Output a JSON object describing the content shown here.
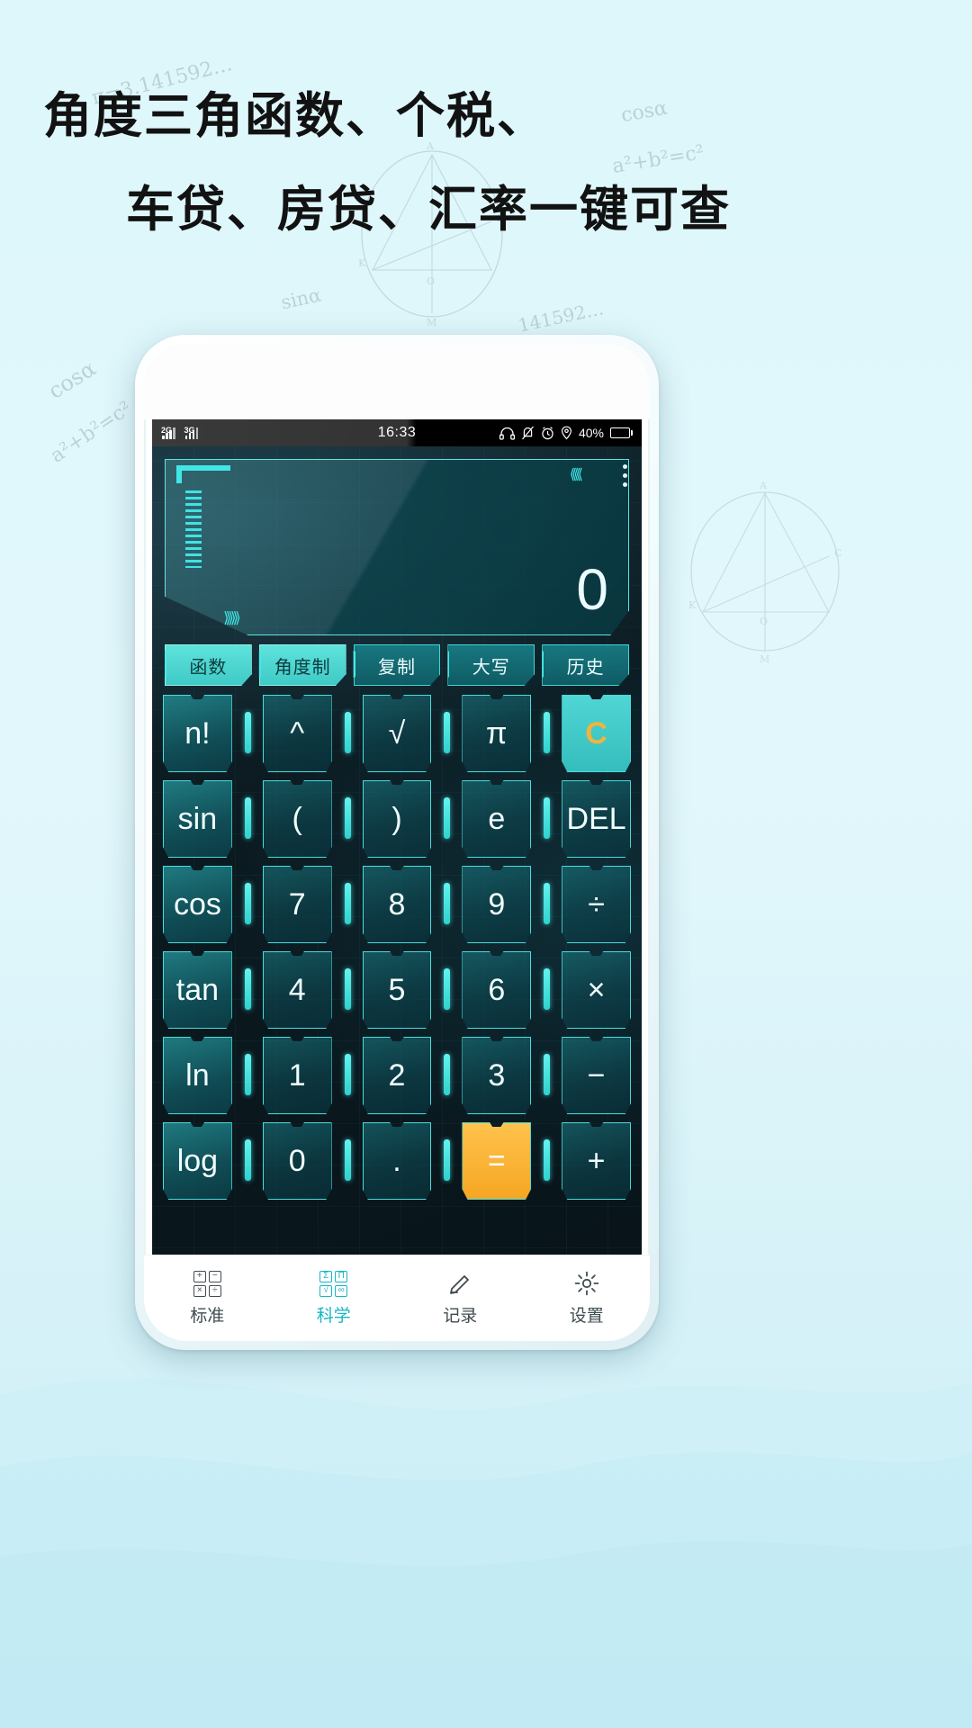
{
  "promo": {
    "line1": "角度三角函数、个税、",
    "line2": "车贷、房贷、汇率一键可查",
    "doodles": [
      "π=3.141592…",
      "cosα",
      "a²+b²=c²",
      "sinα",
      "141592…",
      "cosα",
      "a²+b²=c²"
    ]
  },
  "statusbar": {
    "net2g": "2G",
    "net3g": "3G",
    "time": "16:33",
    "battery_percent": "40%",
    "icons": [
      "headset-icon",
      "mute-bell-icon",
      "alarm-icon",
      "location-icon",
      "battery-icon"
    ]
  },
  "display": {
    "value": "0",
    "menu_icon": "kebab-menu-icon"
  },
  "chips": [
    {
      "label": "函数",
      "active": true
    },
    {
      "label": "角度制",
      "active": true
    },
    {
      "label": "复制",
      "active": false
    },
    {
      "label": "大写",
      "active": false
    },
    {
      "label": "历史",
      "active": false
    }
  ],
  "keypad": [
    [
      {
        "label": "n!",
        "type": "fn"
      },
      {
        "label": "^",
        "type": "op"
      },
      {
        "label": "√",
        "type": "op"
      },
      {
        "label": "π",
        "type": "op"
      },
      {
        "label": "C",
        "type": "clear"
      }
    ],
    [
      {
        "label": "sin",
        "type": "fn"
      },
      {
        "label": "(",
        "type": "op"
      },
      {
        "label": ")",
        "type": "op"
      },
      {
        "label": "e",
        "type": "op"
      },
      {
        "label": "DEL",
        "type": "op"
      }
    ],
    [
      {
        "label": "cos",
        "type": "fn"
      },
      {
        "label": "7",
        "type": "num"
      },
      {
        "label": "8",
        "type": "num"
      },
      {
        "label": "9",
        "type": "num"
      },
      {
        "label": "÷",
        "type": "op"
      }
    ],
    [
      {
        "label": "tan",
        "type": "fn"
      },
      {
        "label": "4",
        "type": "num"
      },
      {
        "label": "5",
        "type": "num"
      },
      {
        "label": "6",
        "type": "num"
      },
      {
        "label": "×",
        "type": "op"
      }
    ],
    [
      {
        "label": "ln",
        "type": "fn"
      },
      {
        "label": "1",
        "type": "num"
      },
      {
        "label": "2",
        "type": "num"
      },
      {
        "label": "3",
        "type": "num"
      },
      {
        "label": "−",
        "type": "op"
      }
    ],
    [
      {
        "label": "log",
        "type": "fn"
      },
      {
        "label": "0",
        "type": "num"
      },
      {
        "label": ".",
        "type": "num"
      },
      {
        "label": "=",
        "type": "equals"
      },
      {
        "label": "+",
        "type": "op"
      }
    ]
  ],
  "nav": [
    {
      "label": "标准",
      "icon": "standard-grid-icon",
      "active": false
    },
    {
      "label": "科学",
      "icon": "science-grid-icon",
      "active": true
    },
    {
      "label": "记录",
      "icon": "pencil-note-icon",
      "active": false
    },
    {
      "label": "设置",
      "icon": "gear-icon",
      "active": false
    }
  ],
  "colors": {
    "page_bg": "#ddf6fa",
    "accent_cyan": "#49dcdc",
    "key_cyan": "#4fd6d4",
    "equals_orange": "#f5a623",
    "nav_active": "#16b6c4"
  }
}
